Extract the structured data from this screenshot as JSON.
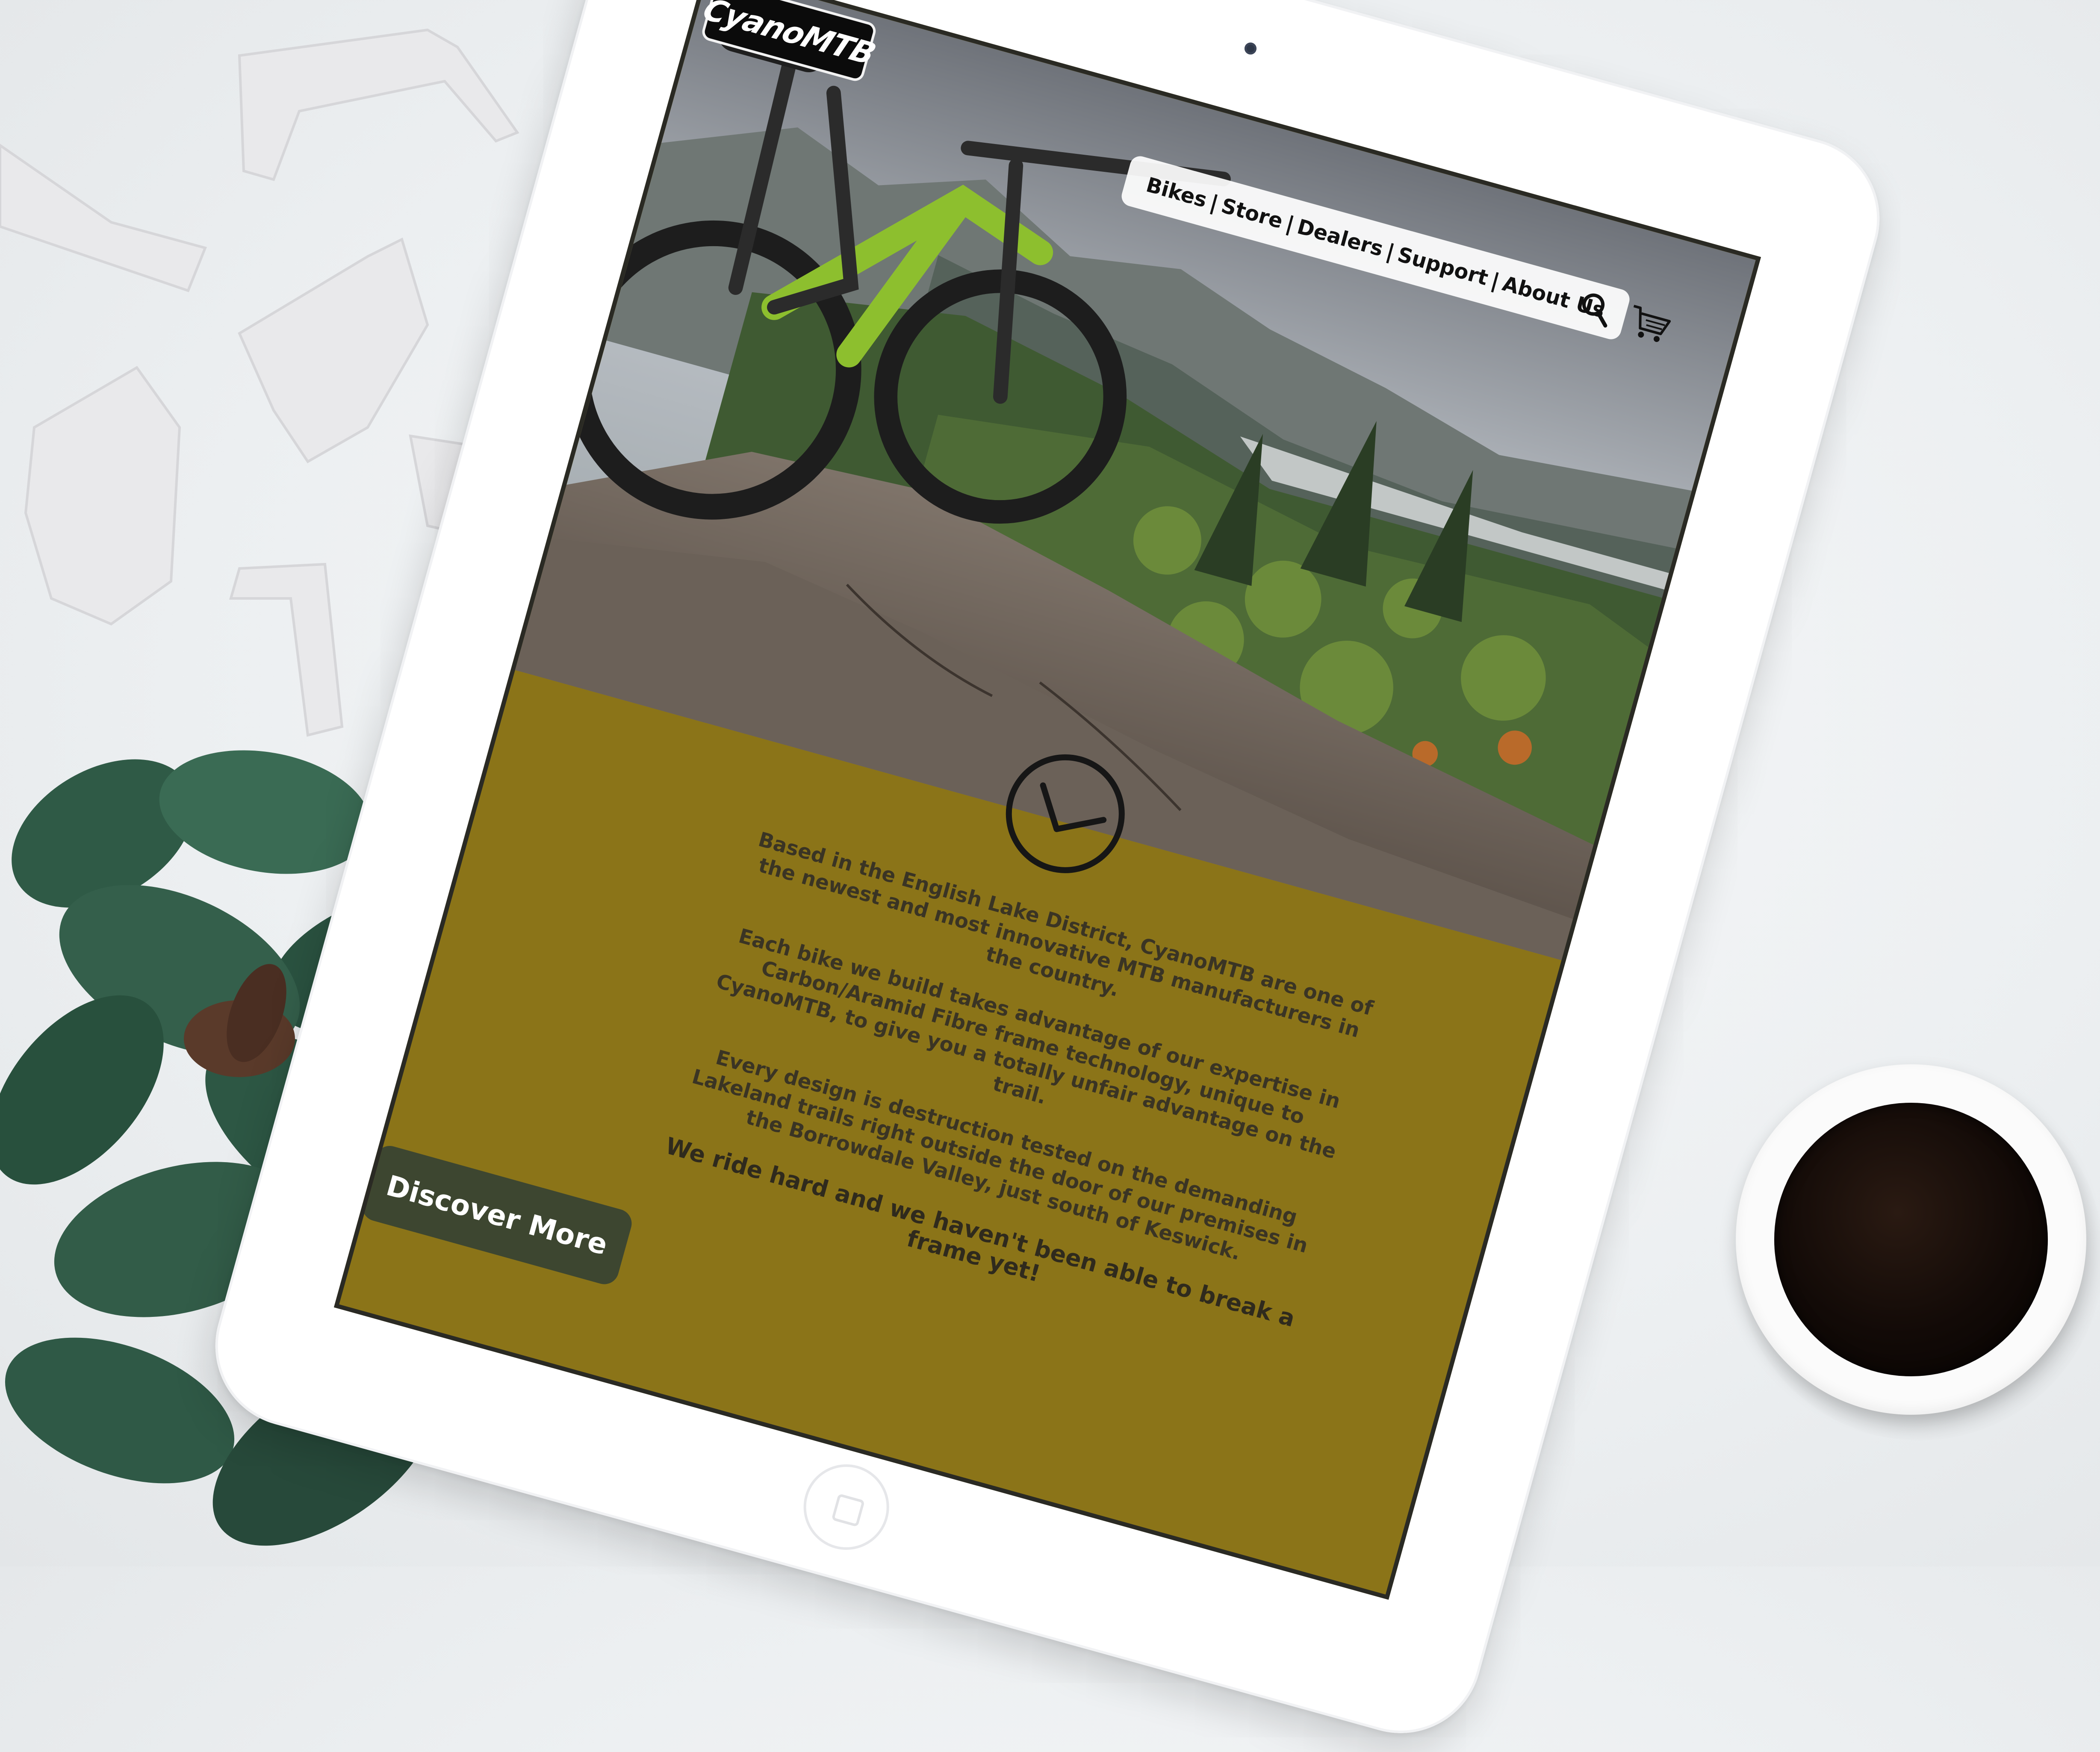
{
  "site": {
    "logo_text": "CyanoMTB"
  },
  "nav": {
    "items": [
      "Bikes",
      "Store",
      "Dealers",
      "Support",
      "About Us"
    ],
    "separator": "|",
    "icons": [
      "search-icon",
      "cart-icon"
    ]
  },
  "intro": {
    "paragraphs": [
      "Based in the English Lake District, CyanoMTB are one of the newest and most innovative MTB manufacturers in the country.",
      "Each bike we build takes advantage of our expertise in Carbon/Aramid Fibre frame technology, unique to CyanoMTB, to give you a totally unfair advantage on the trail.",
      "Every design is destruction tested on the demanding Lakeland trails right outside the door of our premises in the Borrowdale Valley, just south of Keswick."
    ],
    "tagline": "We ride hard and we haven't been able to break a frame yet!"
  },
  "cta": {
    "label": "Discover More"
  },
  "colors": {
    "accent": "#8b7418",
    "button": "#3d4630",
    "text": "#3a3424"
  }
}
